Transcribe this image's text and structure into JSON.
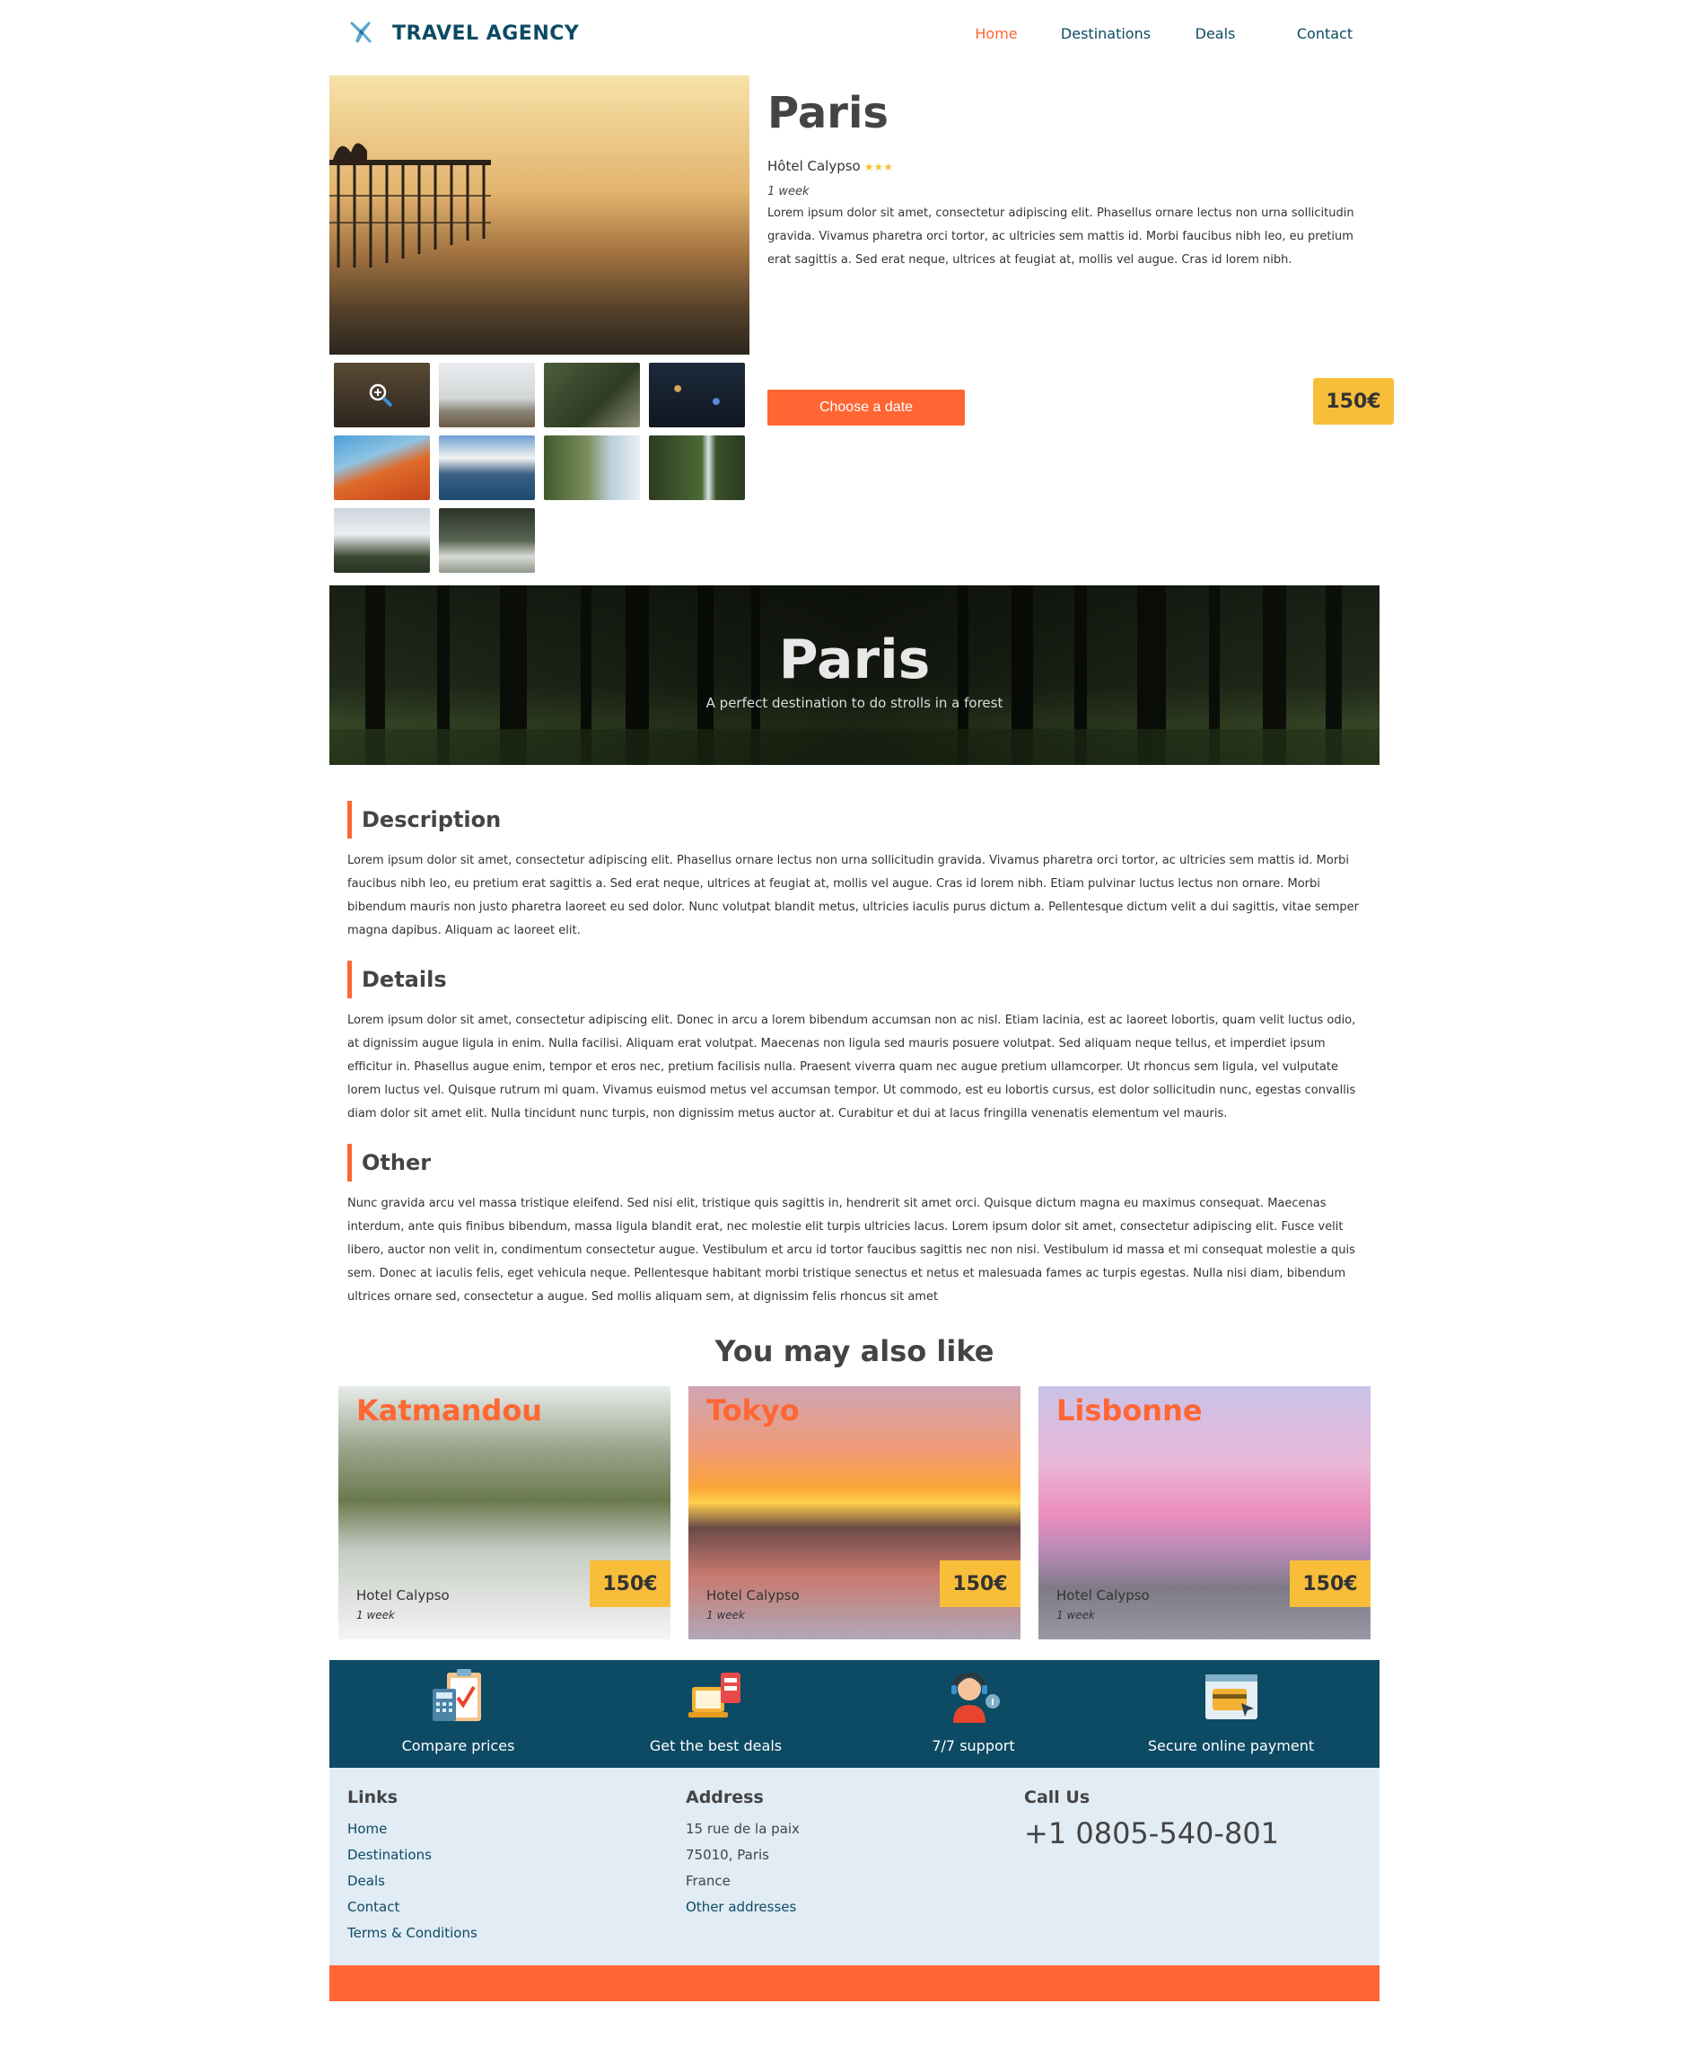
{
  "brand": {
    "name": "TRAVEL AGENCY"
  },
  "nav": {
    "items": [
      "Home",
      "Destinations",
      "Deals",
      "Contact"
    ],
    "active": "Home"
  },
  "product": {
    "title": "Paris",
    "hotel": "Hôtel Calypso",
    "stars": "★★★",
    "duration": "1 week",
    "description": "Lorem ipsum dolor sit amet, consectetur adipiscing elit. Phasellus ornare lectus non urna sollicitudin gravida. Vivamus pharetra orci tortor, ac ultricies sem mattis id. Morbi faucibus nibh leo, eu pretium erat sagittis a. Sed erat neque, ultrices at feugiat at, mollis vel augue. Cras id lorem nibh.",
    "date_button": "Choose a date",
    "price": "150€"
  },
  "banner": {
    "title": "Paris",
    "subtitle": "A perfect destination to do strolls in a forest"
  },
  "sections": [
    {
      "title": "Description",
      "body": "Lorem ipsum dolor sit amet, consectetur adipiscing elit. Phasellus ornare lectus non urna sollicitudin gravida. Vivamus pharetra orci tortor, ac ultricies sem mattis id. Morbi faucibus nibh leo, eu pretium erat sagittis a. Sed erat neque, ultrices at feugiat at, mollis vel augue. Cras id lorem nibh. Etiam pulvinar luctus lectus non ornare. Morbi bibendum mauris non justo pharetra laoreet eu sed dolor. Nunc volutpat blandit metus, ultricies iaculis purus dictum a. Pellentesque dictum velit a dui sagittis, vitae semper magna dapibus. Aliquam ac laoreet elit."
    },
    {
      "title": "Details",
      "body": "Lorem ipsum dolor sit amet, consectetur adipiscing elit. Donec in arcu a lorem bibendum accumsan non ac nisl. Etiam lacinia, est ac laoreet lobortis, quam velit luctus odio, at dignissim augue ligula in enim. Nulla facilisi. Aliquam erat volutpat. Maecenas non ligula sed mauris posuere volutpat. Sed aliquam neque tellus, et imperdiet ipsum efficitur in. Phasellus augue enim, tempor et eros nec, pretium facilisis nulla. Praesent viverra quam nec augue pretium ullamcorper. Ut rhoncus sem ligula, vel vulputate lorem luctus vel. Quisque rutrum mi quam. Vivamus euismod metus vel accumsan tempor. Ut commodo, est eu lobortis cursus, est dolor sollicitudin nunc, egestas convallis diam dolor sit amet elit. Nulla tincidunt nunc turpis, non dignissim metus auctor at. Curabitur et dui at lacus fringilla venenatis elementum vel mauris."
    },
    {
      "title": "Other",
      "body": "Nunc gravida arcu vel massa tristique eleifend. Sed nisi elit, tristique quis sagittis in, hendrerit sit amet orci. Quisque dictum magna eu maximus consequat. Maecenas interdum, ante quis finibus bibendum, massa ligula blandit erat, nec molestie elit turpis ultricies lacus. Lorem ipsum dolor sit amet, consectetur adipiscing elit. Fusce velit libero, auctor non velit in, condimentum consectetur augue. Vestibulum et arcu id tortor faucibus sagittis nec non nisi. Vestibulum id massa et mi consequat molestie a quis sem. Donec at iaculis felis, eget vehicula neque. Pellentesque habitant morbi tristique senectus et netus et malesuada fames ac turpis egestas. Nulla nisi diam, bibendum ultrices ornare sed, consectetur a augue. Sed mollis aliquam sem, at dignissim felis rhoncus sit amet"
    }
  ],
  "also_like": {
    "title": "You may also like",
    "cards": [
      {
        "name": "Katmandou",
        "hotel": "Hotel Calypso",
        "duration": "1 week",
        "price": "150€"
      },
      {
        "name": "Tokyo",
        "hotel": "Hotel Calypso",
        "duration": "1 week",
        "price": "150€"
      },
      {
        "name": "Lisbonne",
        "hotel": "Hotel Calypso",
        "duration": "1 week",
        "price": "150€"
      }
    ]
  },
  "features": [
    {
      "label": "Compare prices",
      "icon": "calculator-clipboard-icon"
    },
    {
      "label": "Get the best deals",
      "icon": "sale-tag-icon"
    },
    {
      "label": "7/7 support",
      "icon": "support-agent-icon"
    },
    {
      "label": "Secure online payment",
      "icon": "credit-card-window-icon"
    }
  ],
  "footer": {
    "links_title": "Links",
    "links": [
      "Home",
      "Destinations",
      "Deals",
      "Contact",
      "Terms & Conditions"
    ],
    "address_title": "Address",
    "address_lines": [
      "15 rue de la paix",
      "75010, Paris",
      "France"
    ],
    "address_link": "Other addresses",
    "call_title": "Call Us",
    "phone": "+1 0805-540-801"
  },
  "colors": {
    "accent": "#ff6633",
    "brand": "#0d4a63",
    "price": "#f8be3a",
    "footer_bg": "#e1ecf5"
  }
}
